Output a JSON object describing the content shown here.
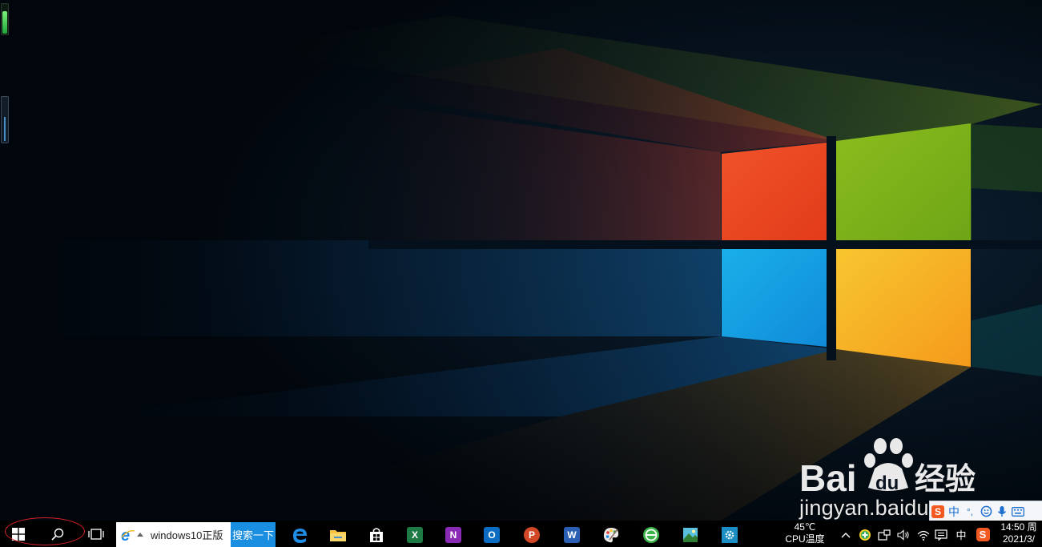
{
  "watermark": {
    "brand": "Bai",
    "brand_du": "du",
    "brand_suffix": "经验",
    "host": "jingyan.baidu.com"
  },
  "taskbar": {
    "start_icon": "windows-logo-icon",
    "search_icon": "search-icon",
    "taskview_icon": "task-view-icon",
    "browser_search": {
      "icon": "ie-icon",
      "value": "windows10正版",
      "button": "搜索一下"
    },
    "apps": [
      {
        "name": "edge",
        "icon": "edge-icon"
      },
      {
        "name": "file-explorer",
        "icon": "folder-icon"
      },
      {
        "name": "store",
        "icon": "store-icon"
      },
      {
        "name": "excel",
        "icon": "excel-icon",
        "letter": "X",
        "color": "#1d7a45"
      },
      {
        "name": "onenote",
        "icon": "onenote-icon",
        "letter": "N",
        "color": "#8a2bb5"
      },
      {
        "name": "outlook",
        "icon": "outlook-icon",
        "letter": "O",
        "color": "#0a6cc2"
      },
      {
        "name": "powerpoint",
        "icon": "powerpoint-icon",
        "letter": "P",
        "color": "#d24726"
      },
      {
        "name": "word",
        "icon": "word-icon",
        "letter": "W",
        "color": "#2b5fb3"
      },
      {
        "name": "paint",
        "icon": "paint-palette-icon"
      },
      {
        "name": "green-app",
        "icon": "green-e-icon"
      },
      {
        "name": "photos",
        "icon": "photo-icon"
      },
      {
        "name": "settings",
        "icon": "gear-icon"
      }
    ],
    "cpu_temp": {
      "value": "45℃",
      "label": "CPU温度"
    },
    "tray": {
      "chevron": "^",
      "ime_mode": "中",
      "sogou": "S"
    },
    "clock": {
      "time": "14:50 周",
      "date": "2021/3/"
    }
  },
  "ime_toolbar": {
    "logo": "S",
    "mode": "中",
    "punct": "°,",
    "items": [
      "smiley-icon",
      "microphone-icon",
      "keyboard-icon"
    ]
  },
  "colors": {
    "taskbar": "#000000",
    "search_button": "#1a8ee0",
    "annotation": "#d9232a",
    "win_red": "#e8441f",
    "win_green": "#7fb61a",
    "win_blue": "#1a9ee0",
    "win_yellow": "#f7b825"
  }
}
